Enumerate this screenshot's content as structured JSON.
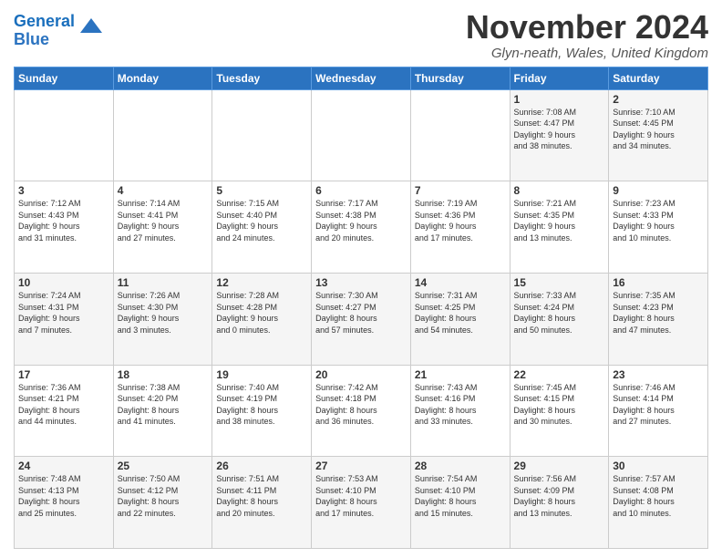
{
  "logo": {
    "line1": "General",
    "line2": "Blue",
    "arrow_color": "#2b73c0"
  },
  "title": "November 2024",
  "location": "Glyn-neath, Wales, United Kingdom",
  "days_of_week": [
    "Sunday",
    "Monday",
    "Tuesday",
    "Wednesday",
    "Thursday",
    "Friday",
    "Saturday"
  ],
  "weeks": [
    [
      {
        "day": "",
        "info": ""
      },
      {
        "day": "",
        "info": ""
      },
      {
        "day": "",
        "info": ""
      },
      {
        "day": "",
        "info": ""
      },
      {
        "day": "",
        "info": ""
      },
      {
        "day": "1",
        "info": "Sunrise: 7:08 AM\nSunset: 4:47 PM\nDaylight: 9 hours\nand 38 minutes."
      },
      {
        "day": "2",
        "info": "Sunrise: 7:10 AM\nSunset: 4:45 PM\nDaylight: 9 hours\nand 34 minutes."
      }
    ],
    [
      {
        "day": "3",
        "info": "Sunrise: 7:12 AM\nSunset: 4:43 PM\nDaylight: 9 hours\nand 31 minutes."
      },
      {
        "day": "4",
        "info": "Sunrise: 7:14 AM\nSunset: 4:41 PM\nDaylight: 9 hours\nand 27 minutes."
      },
      {
        "day": "5",
        "info": "Sunrise: 7:15 AM\nSunset: 4:40 PM\nDaylight: 9 hours\nand 24 minutes."
      },
      {
        "day": "6",
        "info": "Sunrise: 7:17 AM\nSunset: 4:38 PM\nDaylight: 9 hours\nand 20 minutes."
      },
      {
        "day": "7",
        "info": "Sunrise: 7:19 AM\nSunset: 4:36 PM\nDaylight: 9 hours\nand 17 minutes."
      },
      {
        "day": "8",
        "info": "Sunrise: 7:21 AM\nSunset: 4:35 PM\nDaylight: 9 hours\nand 13 minutes."
      },
      {
        "day": "9",
        "info": "Sunrise: 7:23 AM\nSunset: 4:33 PM\nDaylight: 9 hours\nand 10 minutes."
      }
    ],
    [
      {
        "day": "10",
        "info": "Sunrise: 7:24 AM\nSunset: 4:31 PM\nDaylight: 9 hours\nand 7 minutes."
      },
      {
        "day": "11",
        "info": "Sunrise: 7:26 AM\nSunset: 4:30 PM\nDaylight: 9 hours\nand 3 minutes."
      },
      {
        "day": "12",
        "info": "Sunrise: 7:28 AM\nSunset: 4:28 PM\nDaylight: 9 hours\nand 0 minutes."
      },
      {
        "day": "13",
        "info": "Sunrise: 7:30 AM\nSunset: 4:27 PM\nDaylight: 8 hours\nand 57 minutes."
      },
      {
        "day": "14",
        "info": "Sunrise: 7:31 AM\nSunset: 4:25 PM\nDaylight: 8 hours\nand 54 minutes."
      },
      {
        "day": "15",
        "info": "Sunrise: 7:33 AM\nSunset: 4:24 PM\nDaylight: 8 hours\nand 50 minutes."
      },
      {
        "day": "16",
        "info": "Sunrise: 7:35 AM\nSunset: 4:23 PM\nDaylight: 8 hours\nand 47 minutes."
      }
    ],
    [
      {
        "day": "17",
        "info": "Sunrise: 7:36 AM\nSunset: 4:21 PM\nDaylight: 8 hours\nand 44 minutes."
      },
      {
        "day": "18",
        "info": "Sunrise: 7:38 AM\nSunset: 4:20 PM\nDaylight: 8 hours\nand 41 minutes."
      },
      {
        "day": "19",
        "info": "Sunrise: 7:40 AM\nSunset: 4:19 PM\nDaylight: 8 hours\nand 38 minutes."
      },
      {
        "day": "20",
        "info": "Sunrise: 7:42 AM\nSunset: 4:18 PM\nDaylight: 8 hours\nand 36 minutes."
      },
      {
        "day": "21",
        "info": "Sunrise: 7:43 AM\nSunset: 4:16 PM\nDaylight: 8 hours\nand 33 minutes."
      },
      {
        "day": "22",
        "info": "Sunrise: 7:45 AM\nSunset: 4:15 PM\nDaylight: 8 hours\nand 30 minutes."
      },
      {
        "day": "23",
        "info": "Sunrise: 7:46 AM\nSunset: 4:14 PM\nDaylight: 8 hours\nand 27 minutes."
      }
    ],
    [
      {
        "day": "24",
        "info": "Sunrise: 7:48 AM\nSunset: 4:13 PM\nDaylight: 8 hours\nand 25 minutes."
      },
      {
        "day": "25",
        "info": "Sunrise: 7:50 AM\nSunset: 4:12 PM\nDaylight: 8 hours\nand 22 minutes."
      },
      {
        "day": "26",
        "info": "Sunrise: 7:51 AM\nSunset: 4:11 PM\nDaylight: 8 hours\nand 20 minutes."
      },
      {
        "day": "27",
        "info": "Sunrise: 7:53 AM\nSunset: 4:10 PM\nDaylight: 8 hours\nand 17 minutes."
      },
      {
        "day": "28",
        "info": "Sunrise: 7:54 AM\nSunset: 4:10 PM\nDaylight: 8 hours\nand 15 minutes."
      },
      {
        "day": "29",
        "info": "Sunrise: 7:56 AM\nSunset: 4:09 PM\nDaylight: 8 hours\nand 13 minutes."
      },
      {
        "day": "30",
        "info": "Sunrise: 7:57 AM\nSunset: 4:08 PM\nDaylight: 8 hours\nand 10 minutes."
      }
    ]
  ]
}
